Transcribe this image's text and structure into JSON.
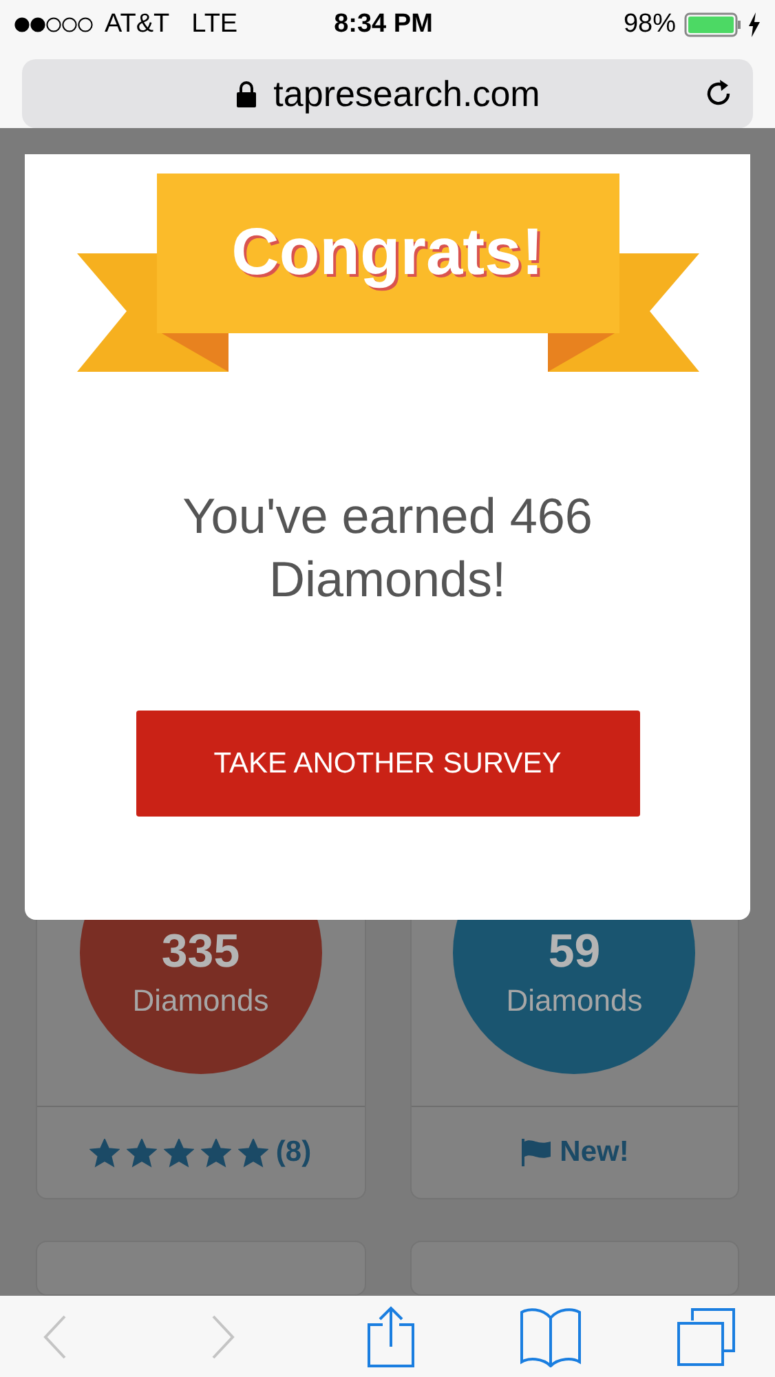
{
  "status_bar": {
    "carrier": "AT&T",
    "network": "LTE",
    "time": "8:34 PM",
    "battery": "98%"
  },
  "address_bar": {
    "url": "tapresearch.com"
  },
  "modal": {
    "banner": "Congrats!",
    "message": "You've earned 466 Diamonds!",
    "button": "TAKE ANOTHER SURVEY"
  },
  "surveys": [
    {
      "kind": "rating",
      "amount": "335",
      "unit": "Diamonds",
      "color": "#7a2e24",
      "stars": 5,
      "count": "(8)"
    },
    {
      "kind": "new",
      "amount": "59",
      "unit": "Diamonds",
      "color": "#1a5570",
      "label": "New!"
    }
  ],
  "toolbar": {
    "back": {
      "disabled": true
    },
    "forward": {
      "disabled": true
    }
  }
}
